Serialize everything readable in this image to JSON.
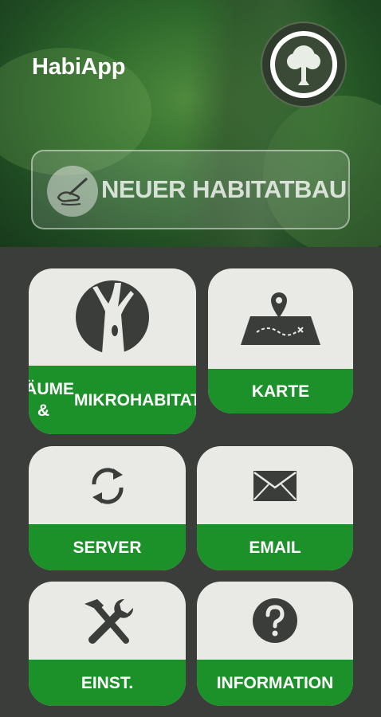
{
  "header": {
    "app_title": "HabiApp",
    "logo_icon": "tree-logo-icon"
  },
  "new_tree_button": {
    "label": "NEUER HABITATBAUM",
    "icon": "pencil-hand-icon"
  },
  "tiles": [
    {
      "label": "BÄUME & MIKROHABITATE",
      "icon": "tree-trunk-icon"
    },
    {
      "label": "KARTE",
      "icon": "map-icon"
    },
    {
      "label": "SERVER",
      "icon": "sync-icon"
    },
    {
      "label": "EMAIL",
      "icon": "envelope-icon"
    },
    {
      "label": "EINST.",
      "icon": "tools-icon"
    },
    {
      "label": "INFORMATION",
      "icon": "question-icon"
    }
  ],
  "colors": {
    "accent_green": "#1c9129",
    "tile_bg": "#e9e9e6",
    "background": "#3a3d3a"
  }
}
